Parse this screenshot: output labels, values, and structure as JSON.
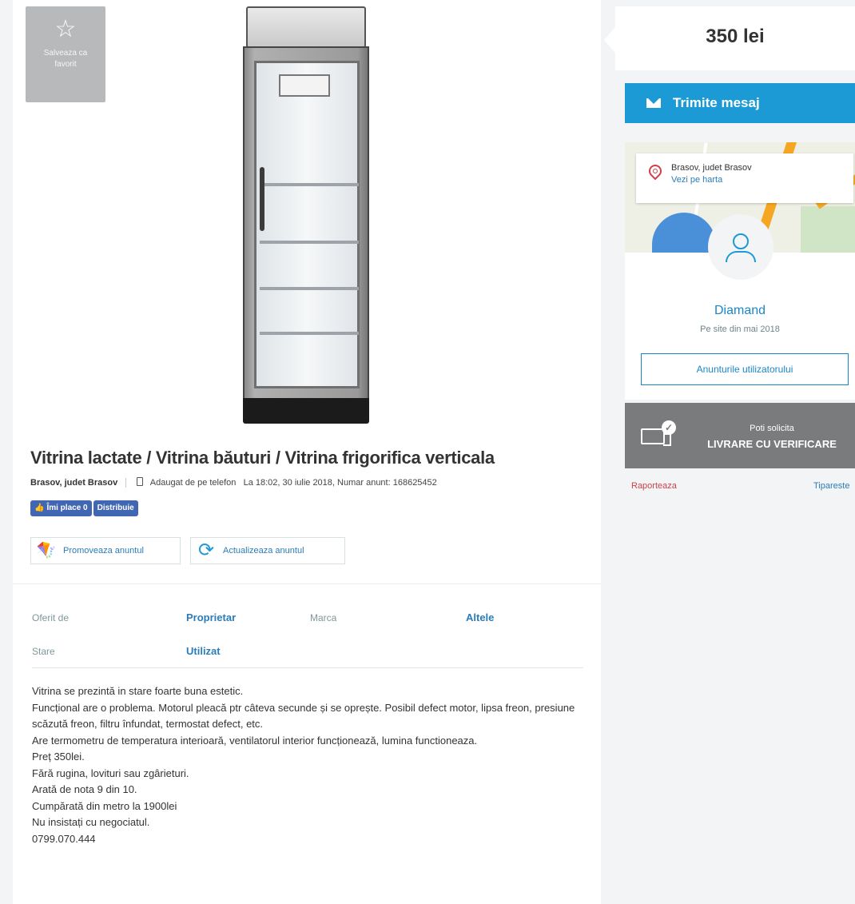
{
  "favorite": {
    "icon": "star-outline-icon",
    "label": "Salveaza ca favorit"
  },
  "ad": {
    "title": "Vitrina lactate / Vitrina băuturi / Vitrina frigorifica verticala",
    "location": "Brasov, judet Brasov",
    "added_from": "Adaugat de pe telefon",
    "added_at": "La 18:02, 30 iulie 2018, Numar anunt: 168625452"
  },
  "facebook": {
    "like_label": "Îmi place 0",
    "share_label": "Distribuie"
  },
  "actions": {
    "promote_label": "Promoveaza anuntul",
    "update_label": "Actualizeaza anuntul"
  },
  "params": [
    {
      "label": "Oferit de",
      "value": "Proprietar"
    },
    {
      "label": "Marca",
      "value": "Altele"
    },
    {
      "label": "Stare",
      "value": "Utilizat"
    }
  ],
  "description": [
    "Vitrina se prezintă in stare foarte buna estetic.",
    "Funcțional are o problema. Motorul pleacă ptr câteva secunde și se oprește. Posibil defect motor, lipsa freon, presiune scăzută freon, filtru înfundat, termostat defect, etc.",
    "Are termometru de temperatura interioară, ventilatorul interior funcționează, lumina functioneaza.",
    "Preț 350lei.",
    "Fără rugina, lovituri sau zgârieturi.",
    "Arată de nota 9 din 10.",
    "Cumpărată din metro la 1900lei",
    "Nu insistați cu negociatul.",
    "0799.070.444"
  ],
  "sidebar": {
    "price": "350 lei",
    "message_button": "Trimite mesaj",
    "map_location": "Brasov, judet Brasov",
    "map_link": "Vezi pe harta",
    "seller_name": "Diamand",
    "seller_since": "Pe site din mai 2018",
    "user_ads_button": "Anunturile utilizatorului",
    "delivery_small": "Poti solicita",
    "delivery_big": "LIVRARE CU VERIFICARE",
    "report_link": "Raporteaza",
    "print_link": "Tipareste"
  },
  "colors": {
    "accent_blue": "#1b9ad6",
    "link_blue": "#2b7cb8",
    "facebook_blue": "#4267b2",
    "delivery_gray": "#7a7b7c"
  }
}
